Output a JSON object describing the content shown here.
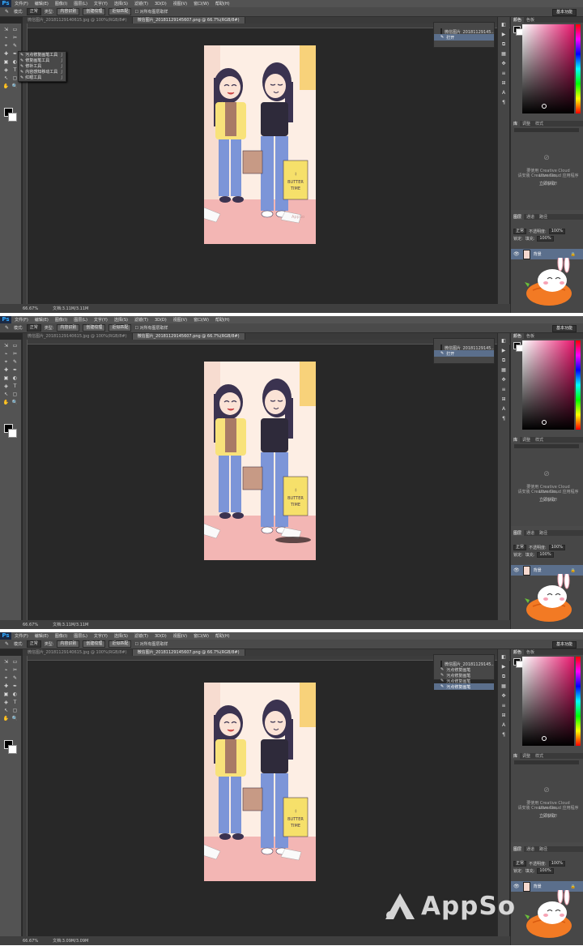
{
  "app": {
    "logo": "Ps",
    "menu": [
      "文件(F)",
      "编辑(E)",
      "图像(I)",
      "图层(L)",
      "文字(Y)",
      "选择(S)",
      "滤镜(T)",
      "3D(D)",
      "视图(V)",
      "窗口(W)",
      "帮助(H)"
    ],
    "workspace": "基本功能"
  },
  "options": {
    "mode_label": "模式:",
    "mode_value": "正常",
    "type_label": "类型:",
    "type_options": [
      "内容识别",
      "创建纹理",
      "近似匹配"
    ],
    "sample_all": "对所有图层取样"
  },
  "frames": [
    {
      "tabs": [
        "微信图片_20181129140615.jpg @ 100%(RGB/8#)",
        "微信图片_20181129145607.png @ 66.7%(RGB/8#)"
      ],
      "active_tab": 1,
      "zoom": "66.67%",
      "doc_info": "文档:3.11M/3.11M",
      "history": [
        "微信图片_20181129145...",
        "打开"
      ],
      "flyout": [
        {
          "label": "污点修复画笔工具",
          "key": "J"
        },
        {
          "label": "修复画笔工具",
          "key": "J"
        },
        {
          "label": "修补工具",
          "key": "J"
        },
        {
          "label": "内容感知移动工具",
          "key": "J"
        },
        {
          "label": "红眼工具",
          "key": "J"
        }
      ]
    },
    {
      "tabs": [
        "微信图片_20181129140615.jpg @ 100%(RGB/8#)",
        "微信图片_20181129145607.png @ 66.7%(RGB/8#)"
      ],
      "active_tab": 1,
      "zoom": "66.67%",
      "doc_info": "文档:3.11M/3.11M",
      "history": [
        "微信图片_20181129145...",
        "打开"
      ]
    },
    {
      "tabs": [
        "微信图片_20181129140615.jpg @ 100%(RGB/8#)",
        "微信图片_20181129145607.png @ 66.7%(RGB/8#)"
      ],
      "active_tab": 1,
      "zoom": "66.67%",
      "doc_info": "文档:3.09M/3.09M",
      "history": [
        "微信图片_20181129145...",
        "污点修复画笔",
        "污点修复画笔",
        "污点修复画笔",
        "污点修复画笔"
      ]
    }
  ],
  "panels": {
    "color_tabs": [
      "颜色",
      "色板"
    ],
    "lib_tabs": [
      "库",
      "调整",
      "样式"
    ],
    "lib_msg_1": "要使用 Creative Cloud Libraries,",
    "lib_msg_2": "请安装 Creative Cloud 应用程序",
    "lib_link": "立即获取!",
    "layer_tabs": [
      "图层",
      "通道",
      "路径"
    ],
    "blend": "正常",
    "opacity_label": "不透明度:",
    "opacity": "100%",
    "lock_label": "锁定:",
    "fill_label": "填充:",
    "fill": "100%",
    "layer_name": "背景"
  },
  "illustration": {
    "bag_text_1": "BUTTER",
    "bag_text_2": "TIME",
    "smile": ":)"
  },
  "watermark": {
    "text": "AppSo"
  },
  "colors": {
    "accent": "#31a8ff",
    "selection": "#5b6f8c",
    "brand_pink": "#e8186e"
  }
}
